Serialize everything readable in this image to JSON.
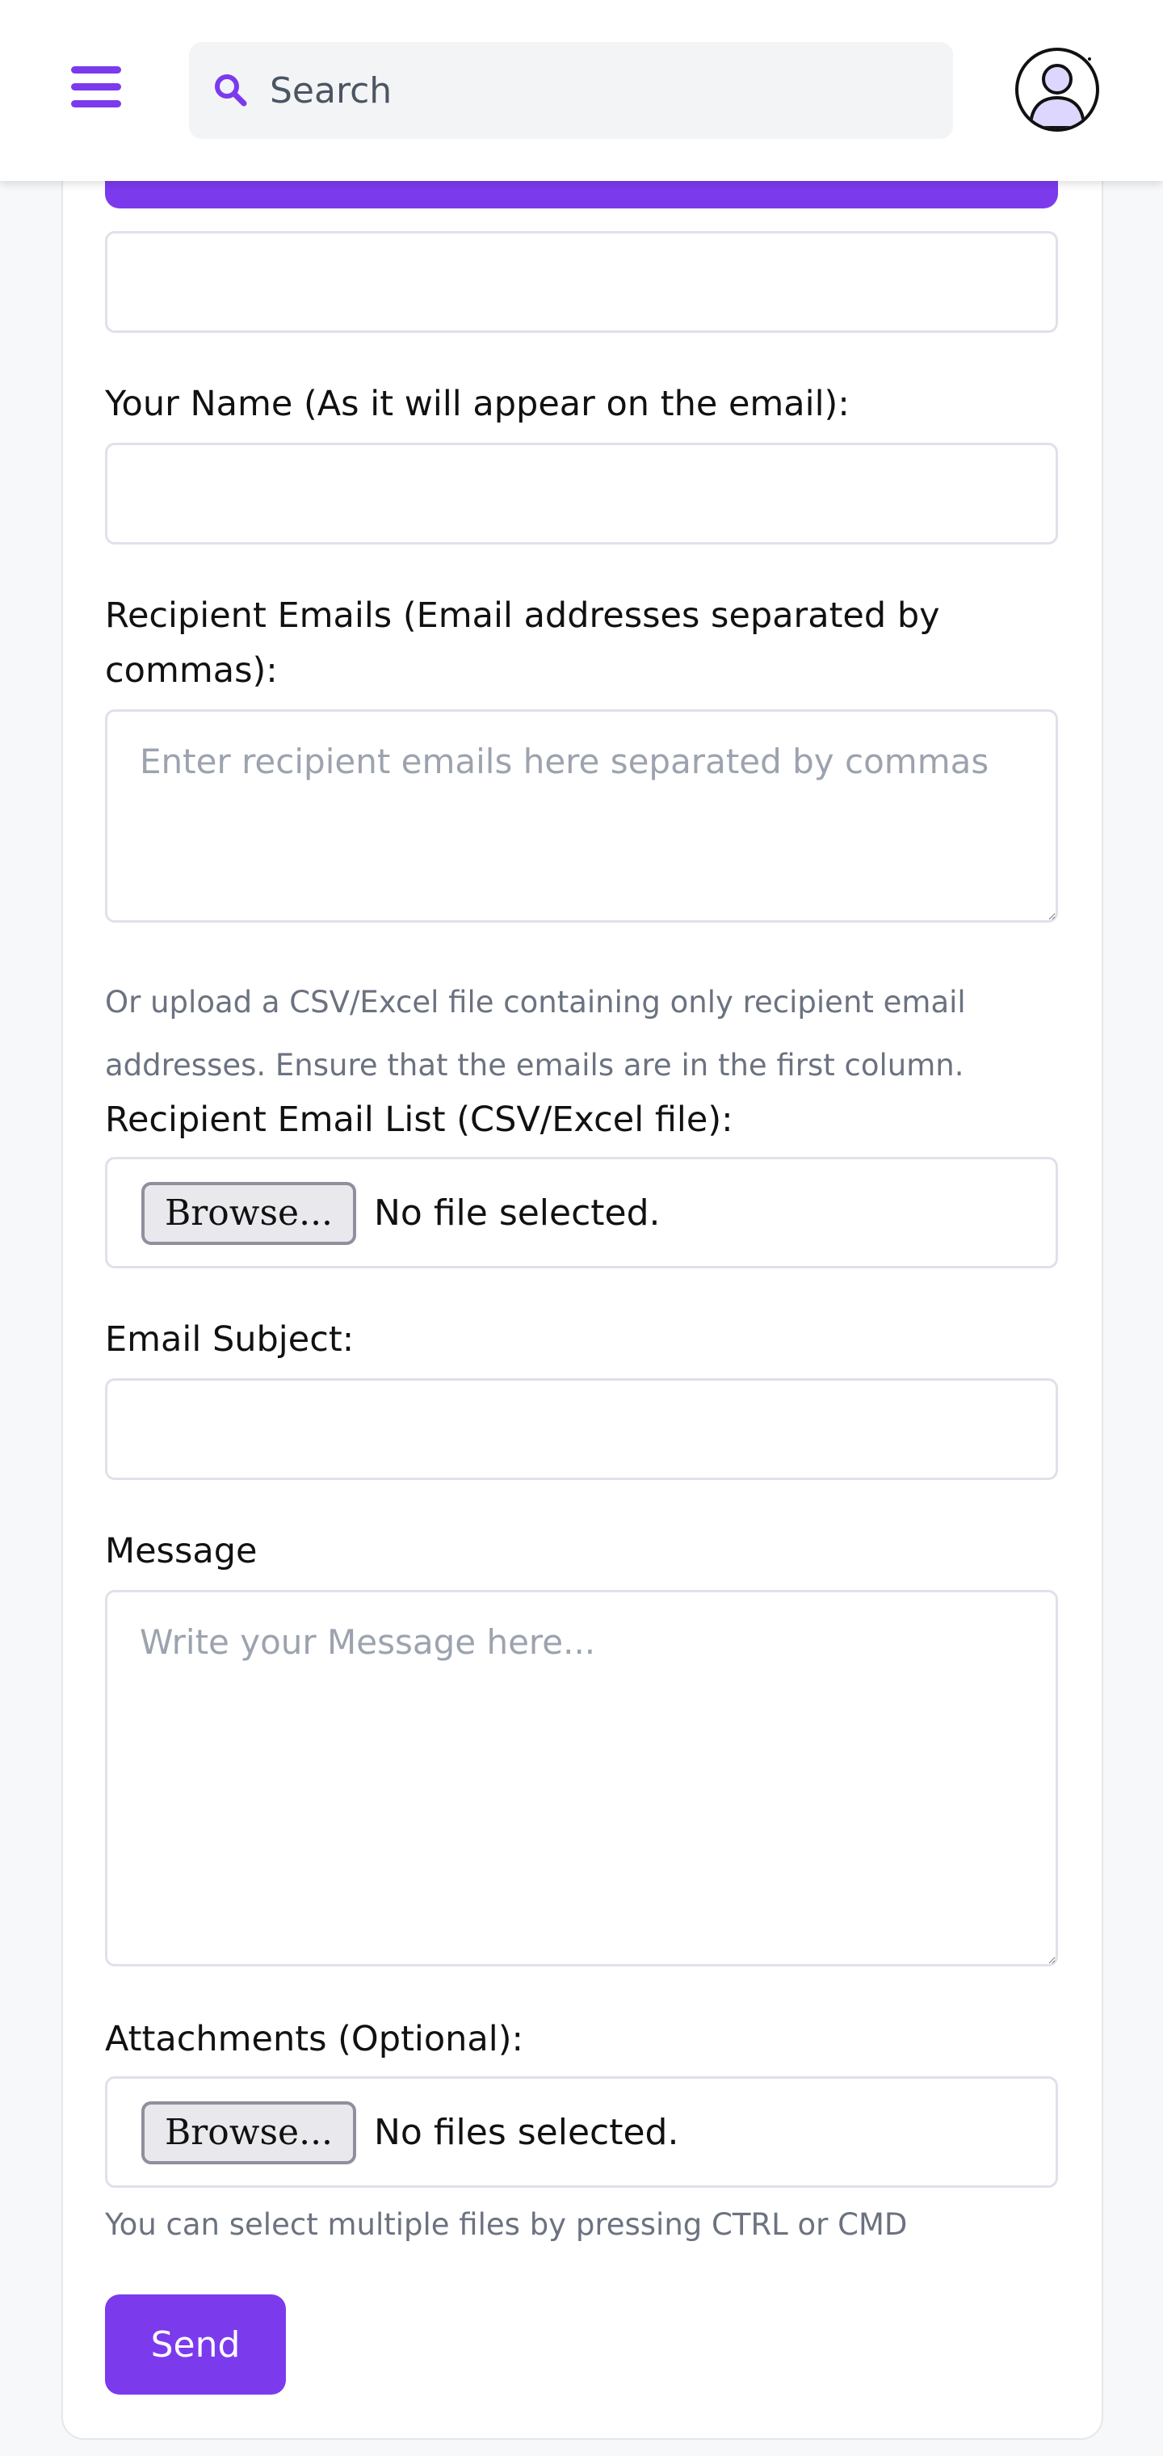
{
  "header": {
    "search_placeholder": "Search"
  },
  "form": {
    "name_label": "Your Name (As it will appear on the email):",
    "recipients_label": "Recipient Emails (Email addresses separated by commas):",
    "recipients_placeholder": "Enter recipient emails here separated by commas",
    "upload_help": "Or upload a CSV/Excel file containing only recipient email addresses. Ensure that the emails are in the first column.",
    "list_label": "Recipient Email List (CSV/Excel file):",
    "list_browse": "Browse...",
    "list_status": "No file selected.",
    "subject_label": "Email Subject:",
    "message_label": "Message",
    "message_placeholder": "Write your Message here...",
    "attachments_label": "Attachments (Optional):",
    "attach_browse": "Browse...",
    "attach_status": "No files selected.",
    "attach_help": "You can select multiple files by pressing CTRL or CMD",
    "send_label": "Send"
  },
  "colors": {
    "accent": "#7c3aed",
    "border": "#dfe1ea",
    "muted_text": "#6b7280",
    "background": "#f7f8fa"
  }
}
